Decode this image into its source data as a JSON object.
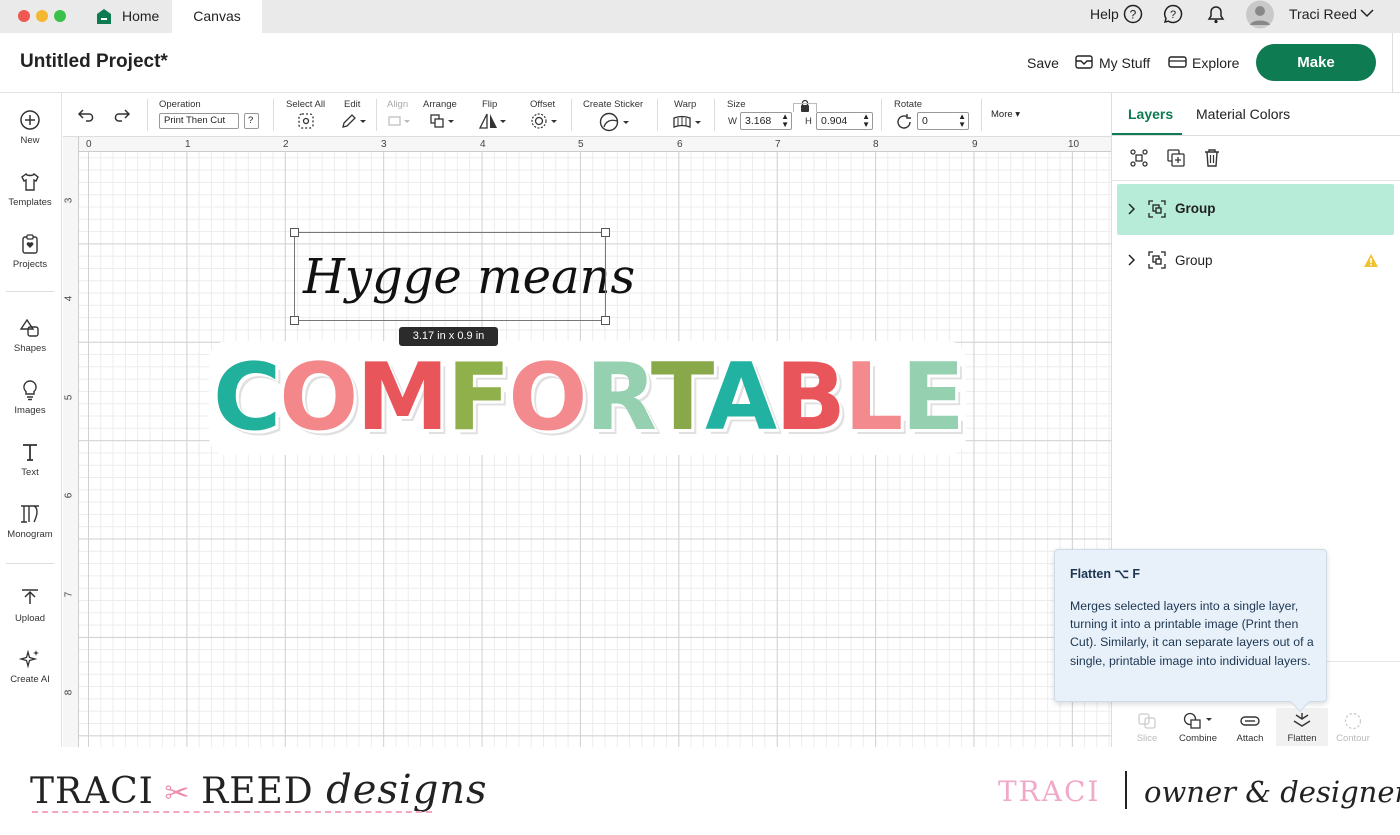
{
  "tabs": {
    "home": "Home",
    "canvas": "Canvas"
  },
  "topbar": {
    "help": "Help",
    "user": "Traci Reed"
  },
  "header": {
    "title": "Untitled Project*",
    "save": "Save",
    "my_stuff": "My Stuff",
    "explore": "Explore",
    "make": "Make"
  },
  "sidebar": {
    "new": "New",
    "templates": "Templates",
    "projects": "Projects",
    "shapes": "Shapes",
    "images": "Images",
    "text": "Text",
    "monogram": "Monogram",
    "upload": "Upload",
    "create_ai": "Create AI"
  },
  "toolbar": {
    "operation_label": "Operation",
    "operation_value": "Print Then Cut",
    "select_all": "Select All",
    "edit": "Edit",
    "align": "Align",
    "arrange": "Arrange",
    "flip": "Flip",
    "offset": "Offset",
    "create_sticker": "Create Sticker",
    "warp": "Warp",
    "size": "Size",
    "w_label": "W",
    "w_value": "3.168",
    "h_label": "H",
    "h_value": "0.904",
    "rotate": "Rotate",
    "rotate_value": "0",
    "more": "More"
  },
  "ruler": {
    "x": [
      "0",
      "1",
      "2",
      "3",
      "4",
      "5",
      "6",
      "7",
      "8",
      "9",
      "10"
    ],
    "y": [
      "3",
      "4",
      "5",
      "6",
      "7",
      "8"
    ]
  },
  "canvas": {
    "text_element": "Hygge means",
    "size_badge": "3.17  in x 0.9  in",
    "word": [
      "C",
      "O",
      "M",
      "F",
      "O",
      "R",
      "T",
      "A",
      "B",
      "L",
      "E"
    ],
    "word_colors": [
      "#21b09b",
      "#f3878a",
      "#e8555a",
      "#8fb04b",
      "#f38b8e",
      "#95d1b1",
      "#88a84a",
      "#22b2a1",
      "#e8555a",
      "#f38b8e",
      "#95d1b1"
    ]
  },
  "right_panel": {
    "tab_layers": "Layers",
    "tab_material": "Material Colors",
    "layers": [
      {
        "name": "Group"
      },
      {
        "name": "Group"
      }
    ],
    "accent": "#0f7b52",
    "selected_bg": "#b7ecd9"
  },
  "tooltip": {
    "title": "Flatten ⌥ F",
    "body": "Merges selected layers into a single layer, turning it into a printable image (Print then Cut). Similarly, it can separate layers out of a single, printable image into individual layers."
  },
  "bottom_actions": {
    "slice": "Slice",
    "combine": "Combine",
    "attach": "Attach",
    "flatten": "Flatten",
    "contour": "Contour"
  },
  "footer": {
    "brand_caps_1": "TRACI",
    "brand_caps_2": "REED",
    "brand_script": "designs",
    "name": "TRACI",
    "role": "owner & designer"
  }
}
